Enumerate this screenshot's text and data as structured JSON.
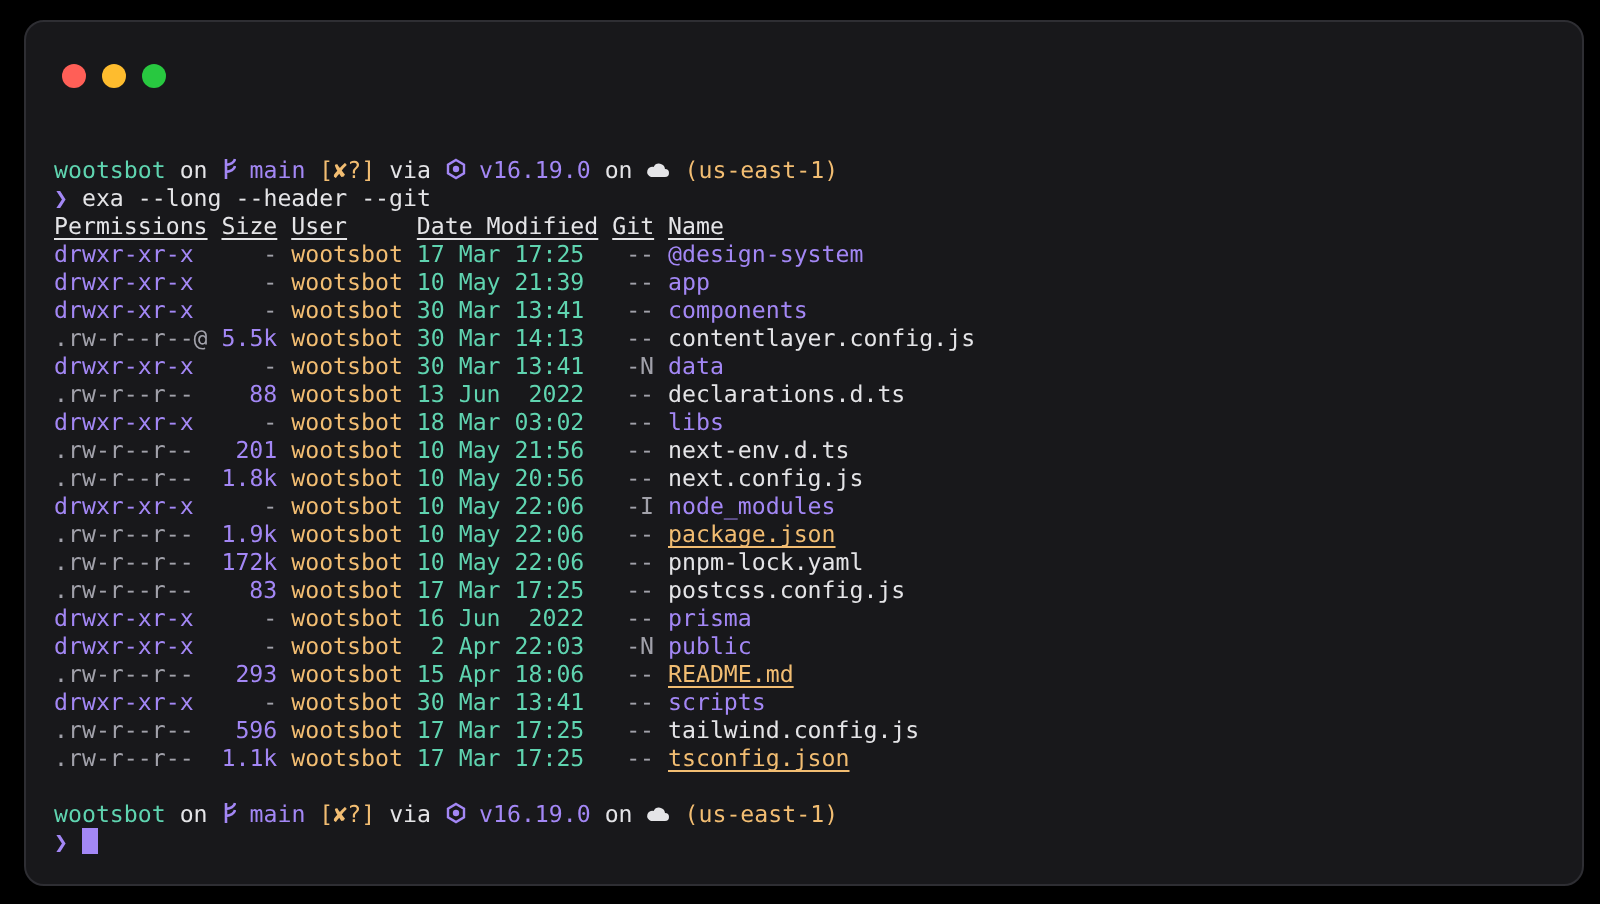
{
  "prompt_top": {
    "user": "wootsbot",
    "on_1": "on",
    "branch": "main",
    "git_status": "[✘?]",
    "via": "via",
    "node_version": "v16.19.0",
    "on_2": "on",
    "region": "(us-east-1)"
  },
  "command": {
    "symbol": "❯",
    "text": "exa --long --header --git"
  },
  "table": {
    "columns": [
      "Permissions",
      "Size",
      "User",
      "Date Modified",
      "Git",
      "Name"
    ],
    "rows": [
      {
        "kind": "dir",
        "permissions": "drwxr-xr-x",
        "size": "-",
        "user": "wootsbot",
        "date": "17 Mar 17:25",
        "git": "--",
        "name": "@design-system"
      },
      {
        "kind": "dir",
        "permissions": "drwxr-xr-x",
        "size": "-",
        "user": "wootsbot",
        "date": "10 May 21:39",
        "git": "--",
        "name": "app"
      },
      {
        "kind": "dir",
        "permissions": "drwxr-xr-x",
        "size": "-",
        "user": "wootsbot",
        "date": "30 Mar 13:41",
        "git": "--",
        "name": "components"
      },
      {
        "kind": "file",
        "permissions": ".rw-r--r--@",
        "size": "5.5k",
        "user": "wootsbot",
        "date": "30 Mar 14:13",
        "git": "--",
        "name": "contentlayer.config.js"
      },
      {
        "kind": "dir",
        "permissions": "drwxr-xr-x",
        "size": "-",
        "user": "wootsbot",
        "date": "30 Mar 13:41",
        "git": "-N",
        "name": "data"
      },
      {
        "kind": "file",
        "permissions": ".rw-r--r--",
        "size": "88",
        "user": "wootsbot",
        "date": "13 Jun  2022",
        "git": "--",
        "name": "declarations.d.ts"
      },
      {
        "kind": "dir",
        "permissions": "drwxr-xr-x",
        "size": "-",
        "user": "wootsbot",
        "date": "18 Mar 03:02",
        "git": "--",
        "name": "libs"
      },
      {
        "kind": "file",
        "permissions": ".rw-r--r--",
        "size": "201",
        "user": "wootsbot",
        "date": "10 May 21:56",
        "git": "--",
        "name": "next-env.d.ts"
      },
      {
        "kind": "file",
        "permissions": ".rw-r--r--",
        "size": "1.8k",
        "user": "wootsbot",
        "date": "10 May 20:56",
        "git": "--",
        "name": "next.config.js"
      },
      {
        "kind": "dir",
        "permissions": "drwxr-xr-x",
        "size": "-",
        "user": "wootsbot",
        "date": "10 May 22:06",
        "git": "-I",
        "name": "node_modules"
      },
      {
        "kind": "special",
        "permissions": ".rw-r--r--",
        "size": "1.9k",
        "user": "wootsbot",
        "date": "10 May 22:06",
        "git": "--",
        "name": "package.json"
      },
      {
        "kind": "file",
        "permissions": ".rw-r--r--",
        "size": "172k",
        "user": "wootsbot",
        "date": "10 May 22:06",
        "git": "--",
        "name": "pnpm-lock.yaml"
      },
      {
        "kind": "file",
        "permissions": ".rw-r--r--",
        "size": "83",
        "user": "wootsbot",
        "date": "17 Mar 17:25",
        "git": "--",
        "name": "postcss.config.js"
      },
      {
        "kind": "dir",
        "permissions": "drwxr-xr-x",
        "size": "-",
        "user": "wootsbot",
        "date": "16 Jun  2022",
        "git": "--",
        "name": "prisma"
      },
      {
        "kind": "dir",
        "permissions": "drwxr-xr-x",
        "size": "-",
        "user": "wootsbot",
        "date": "2 Apr 22:03",
        "git": "-N",
        "name": "public"
      },
      {
        "kind": "special",
        "permissions": ".rw-r--r--",
        "size": "293",
        "user": "wootsbot",
        "date": "15 Apr 18:06",
        "git": "--",
        "name": "README.md"
      },
      {
        "kind": "dir",
        "permissions": "drwxr-xr-x",
        "size": "-",
        "user": "wootsbot",
        "date": "30 Mar 13:41",
        "git": "--",
        "name": "scripts"
      },
      {
        "kind": "file",
        "permissions": ".rw-r--r--",
        "size": "596",
        "user": "wootsbot",
        "date": "17 Mar 17:25",
        "git": "--",
        "name": "tailwind.config.js"
      },
      {
        "kind": "special",
        "permissions": ".rw-r--r--",
        "size": "1.1k",
        "user": "wootsbot",
        "date": "17 Mar 17:25",
        "git": "--",
        "name": "tsconfig.json"
      }
    ]
  },
  "prompt_bottom": {
    "user": "wootsbot",
    "on_1": "on",
    "branch": "main",
    "git_status": "[✘?]",
    "via": "via",
    "node_version": "v16.19.0",
    "on_2": "on",
    "region": "(us-east-1)"
  },
  "input_line": {
    "symbol": "❯"
  }
}
